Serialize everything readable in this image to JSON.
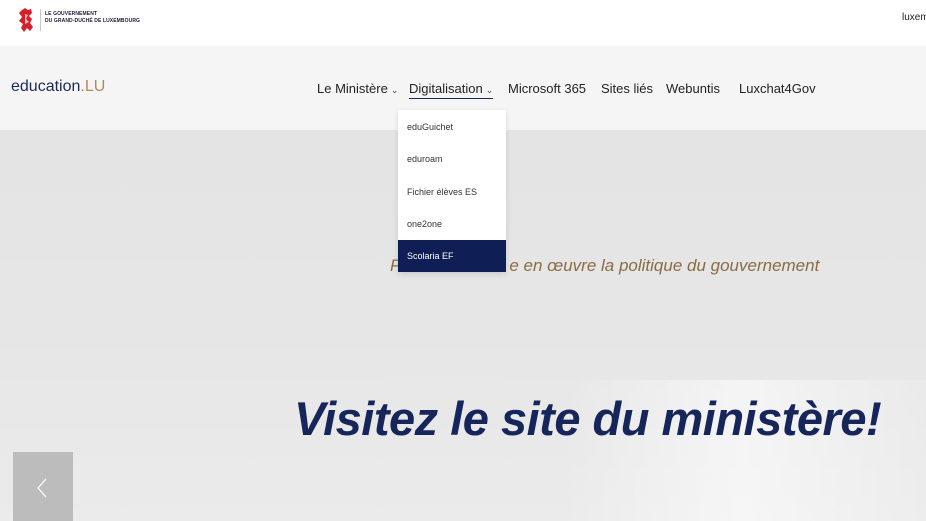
{
  "gov_bar": {
    "line1": "LE GOUVERNEMENT",
    "line2": "DU GRAND-DUCHÉ DE LUXEMBOURG",
    "right_link": "luxembourg"
  },
  "header": {
    "brand_part1": "education",
    "brand_part2": ".LU",
    "nav": [
      {
        "label": "Le Ministère",
        "has_dropdown": true
      },
      {
        "label": "Digitalisation",
        "has_dropdown": true,
        "active": true
      },
      {
        "label": "Microsoft 365"
      },
      {
        "label": "Sites liés"
      },
      {
        "label": "Webuntis"
      },
      {
        "label": "Luxchat4Gov"
      }
    ]
  },
  "dropdown": {
    "items": [
      {
        "label": "eduGuichet"
      },
      {
        "label": "eduroam"
      },
      {
        "label": "Fichier élèves ES"
      },
      {
        "label": "one2one"
      },
      {
        "label": "Scolaria EF",
        "highlighted": true
      }
    ]
  },
  "hero": {
    "subtitle_left": "P",
    "subtitle_right": "e en œuvre la politique du gouvernement",
    "title": "Visitez le site du ministère!"
  },
  "colors": {
    "brand_navy": "#16255a",
    "brand_gold": "#b08a5a",
    "dropdown_selected": "#0f1f55"
  },
  "icons": {
    "crest": "lion-crest-icon",
    "nav_chevron": "chevron-down-icon",
    "slider_prev": "chevron-left-icon"
  }
}
